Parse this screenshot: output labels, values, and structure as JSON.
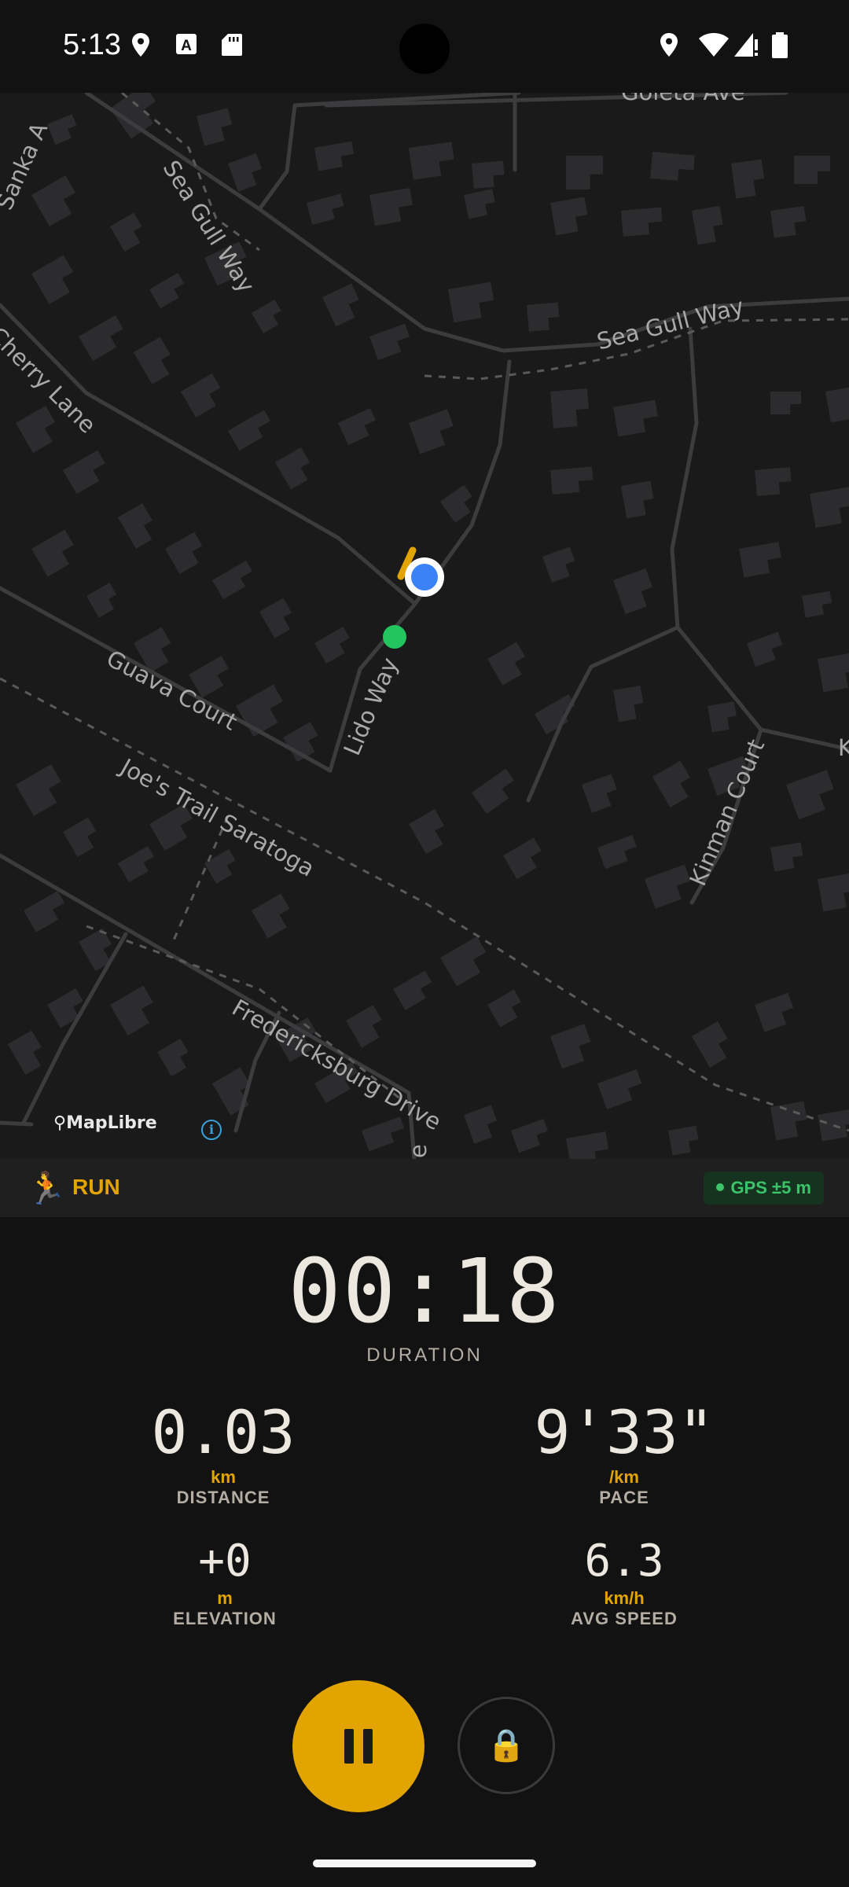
{
  "status_bar": {
    "time": "5:13",
    "left_icons": [
      "location-icon",
      "font-a-icon",
      "sd-card-icon"
    ],
    "right_icons": [
      "location-icon",
      "wifi-icon",
      "signal-icon",
      "battery-icon"
    ]
  },
  "map": {
    "labels": {
      "goleta": "Goleta Ave",
      "sanka": "Sanka A",
      "sea_gull_1": "Sea Gull Way",
      "sea_gull_2": "Sea Gull Way",
      "cherry": "Cherry Lane",
      "guava": "Guava Court",
      "lido": "Lido Way",
      "joes": "Joe's Trail Saratoga",
      "kinman": "Kinman Court",
      "fredericksburg": "Fredericksburg Drive",
      "edge_e": "e",
      "edge_k": "K"
    },
    "attribution": "MapLibre",
    "colors": {
      "background": "#1a1a1b",
      "building": "#2c2c2e",
      "road": "#3c3c3e",
      "route": "#e2a400",
      "current_position": "#3b82f6",
      "start_point": "#22c55e"
    }
  },
  "activity": {
    "icon": "running-person-icon",
    "type": "RUN",
    "gps_status": "GPS ±5 m"
  },
  "stats": {
    "duration": {
      "value": "00:18",
      "label": "DURATION"
    },
    "distance": {
      "value": "0.03",
      "unit": "km",
      "label": "DISTANCE"
    },
    "pace": {
      "value": "9'33\"",
      "unit": "/km",
      "label": "PACE"
    },
    "elevation": {
      "value": "+0",
      "unit": "m",
      "label": "ELEVATION"
    },
    "avg_speed": {
      "value": "6.3",
      "unit": "km/h",
      "label": "AVG SPEED"
    }
  },
  "controls": {
    "pause_icon": "pause-icon",
    "lock_icon": "lock-icon",
    "lock_glyph": "🔒"
  },
  "colors": {
    "accent": "#e2a400",
    "gps_ok": "#3cc46a",
    "background": "#121212"
  }
}
